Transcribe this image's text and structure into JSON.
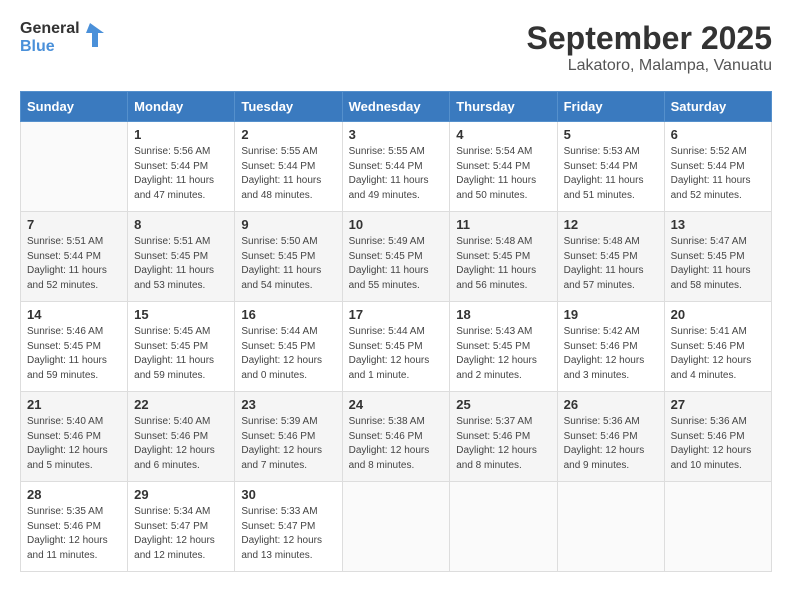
{
  "header": {
    "logo_general": "General",
    "logo_blue": "Blue",
    "month_title": "September 2025",
    "location": "Lakatoro, Malampa, Vanuatu"
  },
  "days_of_week": [
    "Sunday",
    "Monday",
    "Tuesday",
    "Wednesday",
    "Thursday",
    "Friday",
    "Saturday"
  ],
  "weeks": [
    [
      {
        "day": "",
        "info": ""
      },
      {
        "day": "1",
        "info": "Sunrise: 5:56 AM\nSunset: 5:44 PM\nDaylight: 11 hours\nand 47 minutes."
      },
      {
        "day": "2",
        "info": "Sunrise: 5:55 AM\nSunset: 5:44 PM\nDaylight: 11 hours\nand 48 minutes."
      },
      {
        "day": "3",
        "info": "Sunrise: 5:55 AM\nSunset: 5:44 PM\nDaylight: 11 hours\nand 49 minutes."
      },
      {
        "day": "4",
        "info": "Sunrise: 5:54 AM\nSunset: 5:44 PM\nDaylight: 11 hours\nand 50 minutes."
      },
      {
        "day": "5",
        "info": "Sunrise: 5:53 AM\nSunset: 5:44 PM\nDaylight: 11 hours\nand 51 minutes."
      },
      {
        "day": "6",
        "info": "Sunrise: 5:52 AM\nSunset: 5:44 PM\nDaylight: 11 hours\nand 52 minutes."
      }
    ],
    [
      {
        "day": "7",
        "info": "Sunrise: 5:51 AM\nSunset: 5:44 PM\nDaylight: 11 hours\nand 52 minutes."
      },
      {
        "day": "8",
        "info": "Sunrise: 5:51 AM\nSunset: 5:45 PM\nDaylight: 11 hours\nand 53 minutes."
      },
      {
        "day": "9",
        "info": "Sunrise: 5:50 AM\nSunset: 5:45 PM\nDaylight: 11 hours\nand 54 minutes."
      },
      {
        "day": "10",
        "info": "Sunrise: 5:49 AM\nSunset: 5:45 PM\nDaylight: 11 hours\nand 55 minutes."
      },
      {
        "day": "11",
        "info": "Sunrise: 5:48 AM\nSunset: 5:45 PM\nDaylight: 11 hours\nand 56 minutes."
      },
      {
        "day": "12",
        "info": "Sunrise: 5:48 AM\nSunset: 5:45 PM\nDaylight: 11 hours\nand 57 minutes."
      },
      {
        "day": "13",
        "info": "Sunrise: 5:47 AM\nSunset: 5:45 PM\nDaylight: 11 hours\nand 58 minutes."
      }
    ],
    [
      {
        "day": "14",
        "info": "Sunrise: 5:46 AM\nSunset: 5:45 PM\nDaylight: 11 hours\nand 59 minutes."
      },
      {
        "day": "15",
        "info": "Sunrise: 5:45 AM\nSunset: 5:45 PM\nDaylight: 11 hours\nand 59 minutes."
      },
      {
        "day": "16",
        "info": "Sunrise: 5:44 AM\nSunset: 5:45 PM\nDaylight: 12 hours\nand 0 minutes."
      },
      {
        "day": "17",
        "info": "Sunrise: 5:44 AM\nSunset: 5:45 PM\nDaylight: 12 hours\nand 1 minute."
      },
      {
        "day": "18",
        "info": "Sunrise: 5:43 AM\nSunset: 5:45 PM\nDaylight: 12 hours\nand 2 minutes."
      },
      {
        "day": "19",
        "info": "Sunrise: 5:42 AM\nSunset: 5:46 PM\nDaylight: 12 hours\nand 3 minutes."
      },
      {
        "day": "20",
        "info": "Sunrise: 5:41 AM\nSunset: 5:46 PM\nDaylight: 12 hours\nand 4 minutes."
      }
    ],
    [
      {
        "day": "21",
        "info": "Sunrise: 5:40 AM\nSunset: 5:46 PM\nDaylight: 12 hours\nand 5 minutes."
      },
      {
        "day": "22",
        "info": "Sunrise: 5:40 AM\nSunset: 5:46 PM\nDaylight: 12 hours\nand 6 minutes."
      },
      {
        "day": "23",
        "info": "Sunrise: 5:39 AM\nSunset: 5:46 PM\nDaylight: 12 hours\nand 7 minutes."
      },
      {
        "day": "24",
        "info": "Sunrise: 5:38 AM\nSunset: 5:46 PM\nDaylight: 12 hours\nand 8 minutes."
      },
      {
        "day": "25",
        "info": "Sunrise: 5:37 AM\nSunset: 5:46 PM\nDaylight: 12 hours\nand 8 minutes."
      },
      {
        "day": "26",
        "info": "Sunrise: 5:36 AM\nSunset: 5:46 PM\nDaylight: 12 hours\nand 9 minutes."
      },
      {
        "day": "27",
        "info": "Sunrise: 5:36 AM\nSunset: 5:46 PM\nDaylight: 12 hours\nand 10 minutes."
      }
    ],
    [
      {
        "day": "28",
        "info": "Sunrise: 5:35 AM\nSunset: 5:46 PM\nDaylight: 12 hours\nand 11 minutes."
      },
      {
        "day": "29",
        "info": "Sunrise: 5:34 AM\nSunset: 5:47 PM\nDaylight: 12 hours\nand 12 minutes."
      },
      {
        "day": "30",
        "info": "Sunrise: 5:33 AM\nSunset: 5:47 PM\nDaylight: 12 hours\nand 13 minutes."
      },
      {
        "day": "",
        "info": ""
      },
      {
        "day": "",
        "info": ""
      },
      {
        "day": "",
        "info": ""
      },
      {
        "day": "",
        "info": ""
      }
    ]
  ]
}
